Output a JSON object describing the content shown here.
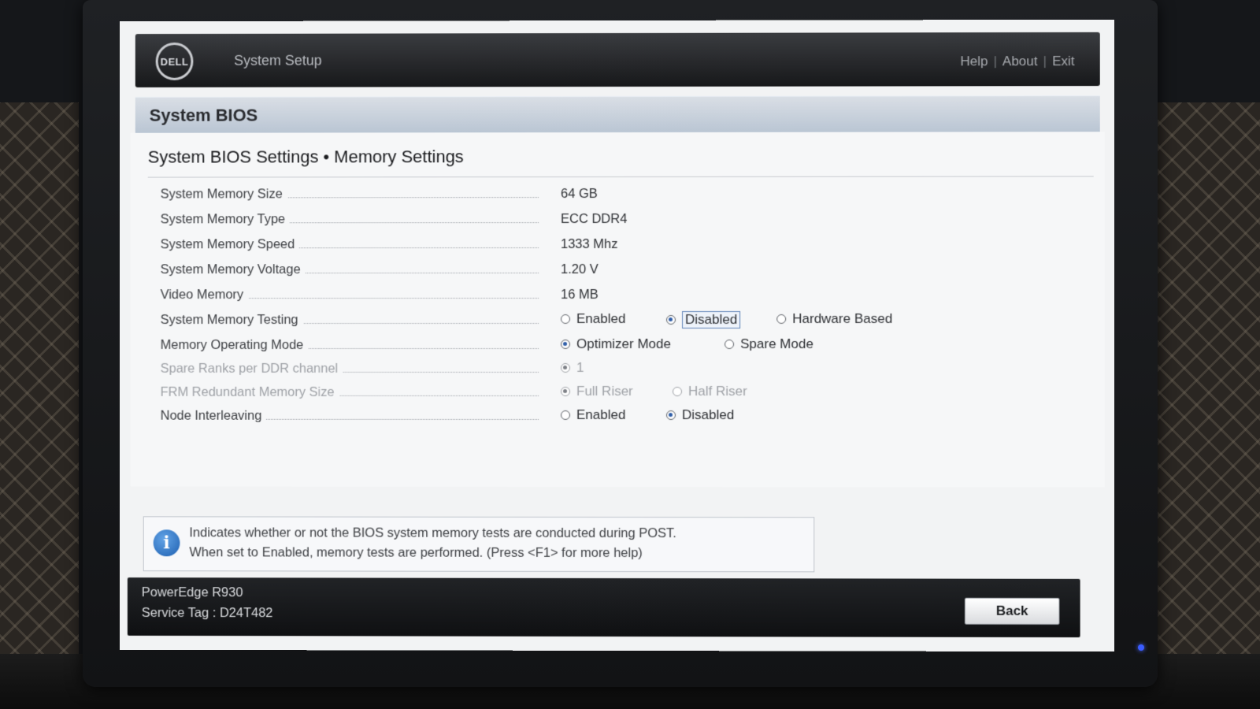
{
  "header": {
    "logo_text": "DELL",
    "app_title": "System Setup",
    "links": [
      "Help",
      "About",
      "Exit"
    ]
  },
  "section_title": "System BIOS",
  "subheading": "System BIOS Settings • Memory Settings",
  "settings": [
    {
      "label": "System Memory Size",
      "value": "64 GB"
    },
    {
      "label": "System Memory Type",
      "value": "ECC DDR4"
    },
    {
      "label": "System Memory Speed",
      "value": "1333 Mhz"
    },
    {
      "label": "System Memory Voltage",
      "value": "1.20 V"
    },
    {
      "label": "Video Memory",
      "value": "16 MB"
    },
    {
      "label": "System Memory Testing",
      "options": [
        "Enabled",
        "Disabled",
        "Hardware Based"
      ],
      "selected": "Disabled",
      "focused": true
    },
    {
      "label": "Memory Operating Mode",
      "options": [
        "Optimizer Mode",
        "Spare Mode"
      ],
      "selected": "Optimizer Mode"
    },
    {
      "label": "Spare Ranks per DDR channel",
      "options": [
        "1"
      ],
      "selected": "1",
      "disabled": true
    },
    {
      "label": "FRM Redundant Memory Size",
      "options": [
        "Full Riser",
        "Half Riser"
      ],
      "selected": "Full Riser",
      "disabled": true
    },
    {
      "label": "Node Interleaving",
      "options": [
        "Enabled",
        "Disabled"
      ],
      "selected": "Disabled"
    }
  ],
  "info": {
    "icon": "info-icon",
    "line1": "Indicates whether or not the BIOS system memory tests are conducted during POST.",
    "line2": "When set to Enabled, memory tests are performed. (Press <F1> for more help)"
  },
  "footer": {
    "model": "PowerEdge R930",
    "service_tag": "Service Tag : D24T482",
    "back_label": "Back"
  },
  "colors": {
    "header_bg": "#17181a",
    "section_bar": "#b9c5d3",
    "radio_selected": "#2f5ea8",
    "info_icon": "#1d5fb0"
  }
}
